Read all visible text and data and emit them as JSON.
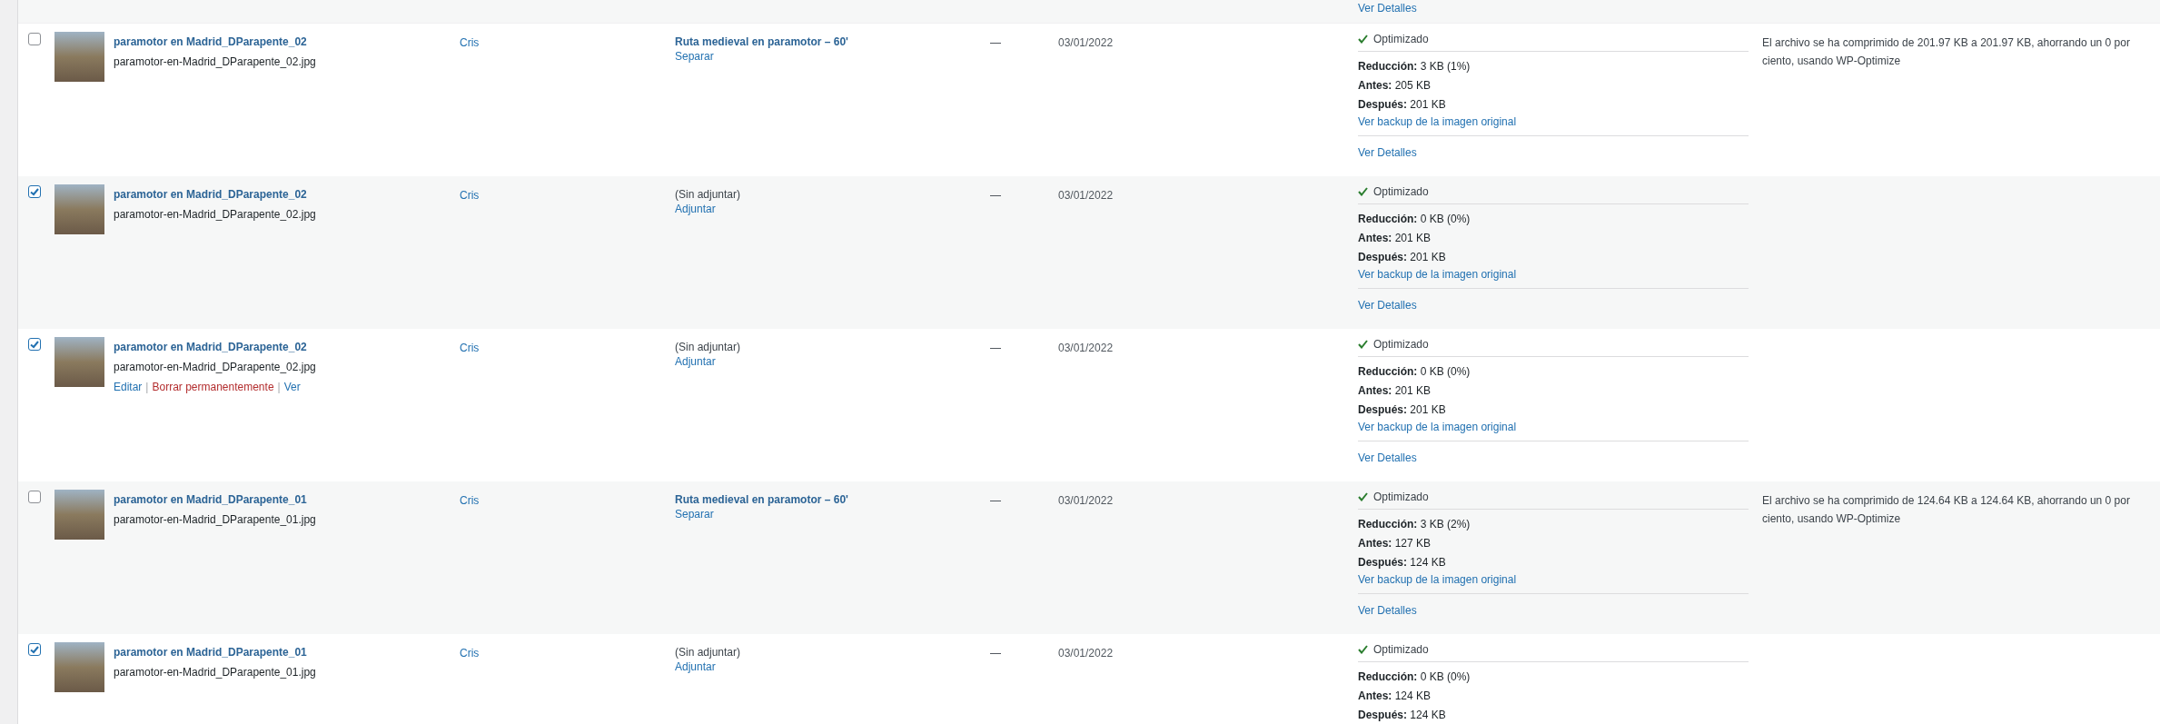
{
  "previous_row": {
    "link": "Ver Detalles"
  },
  "rows": [
    {
      "checked": false,
      "title": "paramotor en Madrid_DParapente_02",
      "filename": "paramotor-en-Madrid_DParapente_02.jpg",
      "author": "Cris",
      "attached": {
        "kind": "post",
        "text": "Ruta medieval en paramotor – 60'",
        "action": "Separar"
      },
      "column_5": "—",
      "date": "03/01/2022",
      "optimization": {
        "status": "Optimizado",
        "lines": [
          "**Reducción:** 3 KB (1%)",
          "**Antes:** 205 KB",
          "**Después:** 201 KB"
        ],
        "backup_link": "Ver backup de la imagen original",
        "details_link": "Ver Detalles"
      },
      "note": "El archivo se ha comprimido de 201.97 KB a 201.97 KB, ahorrando un 0 por ciento, usando WP-Optimize"
    },
    {
      "checked": true,
      "title": "paramotor en Madrid_DParapente_02",
      "filename": "paramotor-en-Madrid_DParapente_02.jpg",
      "author": "Cris",
      "attached": {
        "kind": "none",
        "text": "(Sin adjuntar)",
        "action": "Adjuntar"
      },
      "column_5": "—",
      "date": "03/01/2022",
      "optimization": {
        "status": "Optimizado",
        "lines": [
          "**Reducción:** 0 KB (0%)",
          "**Antes:** 201 KB",
          "**Después:** 201 KB"
        ],
        "backup_link": "Ver backup de la imagen original",
        "details_link": "Ver Detalles"
      }
    },
    {
      "checked": true,
      "title": "paramotor en Madrid_DParapente_02",
      "filename": "paramotor-en-Madrid_DParapente_02.jpg",
      "row_action_separator": "|",
      "row_actions": [
        {
          "kind": "link",
          "label": "Editar"
        },
        {
          "kind": "delete",
          "label": "Borrar permanentemente"
        },
        {
          "kind": "link",
          "label": "Ver"
        }
      ],
      "author": "Cris",
      "attached": {
        "kind": "none",
        "text": "(Sin adjuntar)",
        "action": "Adjuntar"
      },
      "column_5": "—",
      "date": "03/01/2022",
      "optimization": {
        "status": "Optimizado",
        "lines": [
          "**Reducción:** 0 KB (0%)",
          "**Antes:** 201 KB",
          "**Después:** 201 KB"
        ],
        "backup_link": "Ver backup de la imagen original",
        "details_link": "Ver Detalles"
      }
    },
    {
      "checked": false,
      "title": "paramotor en Madrid_DParapente_01",
      "filename": "paramotor-en-Madrid_DParapente_01.jpg",
      "author": "Cris",
      "attached": {
        "kind": "post",
        "text": "Ruta medieval en paramotor – 60'",
        "action": "Separar"
      },
      "column_5": "—",
      "date": "03/01/2022",
      "optimization": {
        "status": "Optimizado",
        "lines": [
          "**Reducción:** 3 KB (2%)",
          "**Antes:** 127 KB",
          "**Después:** 124 KB"
        ],
        "backup_link": "Ver backup de la imagen original",
        "details_link": "Ver Detalles"
      },
      "note": "El archivo se ha comprimido de 124.64 KB a 124.64 KB, ahorrando un 0 por ciento, usando WP-Optimize"
    },
    {
      "checked": true,
      "title": "paramotor en Madrid_DParapente_01",
      "filename": "paramotor-en-Madrid_DParapente_01.jpg",
      "author": "Cris",
      "attached": {
        "kind": "none",
        "text": "(Sin adjuntar)",
        "action": "Adjuntar"
      },
      "column_5": "—",
      "date": "03/01/2022",
      "optimization": {
        "status": "Optimizado",
        "lines": [
          "**Reducción:** 0 KB (0%)",
          "**Antes:** 124 KB",
          "**Después:** 124 KB"
        ]
      }
    }
  ]
}
